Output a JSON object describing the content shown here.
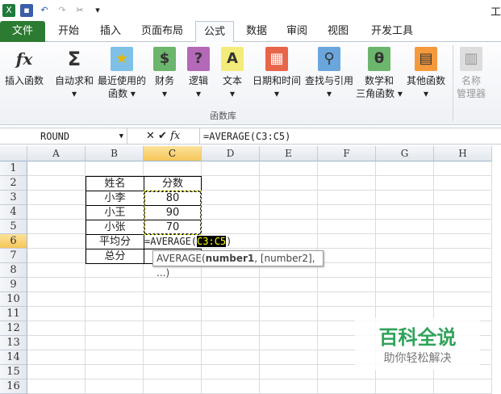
{
  "title": "工",
  "tabs": [
    "文件",
    "开始",
    "插入",
    "页面布局",
    "公式",
    "数据",
    "审阅",
    "视图",
    "开发工具"
  ],
  "active_tab": "公式",
  "ribbon": {
    "buttons": [
      {
        "label": "插入函数",
        "icon": "fx"
      },
      {
        "label": "自动求和",
        "label2": "▾",
        "icon": "Σ"
      },
      {
        "label": "最近使用的",
        "label2": "函数 ▾",
        "icon": "★"
      },
      {
        "label": "财务",
        "label2": "▾",
        "icon": "$"
      },
      {
        "label": "逻辑",
        "label2": "▾",
        "icon": "?"
      },
      {
        "label": "文本",
        "label2": "▾",
        "icon": "A"
      },
      {
        "label": "日期和时间",
        "label2": "▾",
        "icon": "▦"
      },
      {
        "label": "查找与引用",
        "label2": "▾",
        "icon": "⚲"
      },
      {
        "label": "数学和",
        "label2": "三角函数 ▾",
        "icon": "θ"
      },
      {
        "label": "其他函数",
        "label2": "▾",
        "icon": "▤"
      },
      {
        "label": "名称",
        "label2": "管理器",
        "icon": "▥"
      }
    ],
    "group_label": "函数库"
  },
  "formula_bar": {
    "name_box": "ROUND",
    "value": "=AVERAGE(C3:C5)",
    "fx": "fx"
  },
  "columns": [
    "A",
    "B",
    "C",
    "D",
    "E",
    "F",
    "G",
    "H"
  ],
  "rows": [
    "1",
    "2",
    "3",
    "4",
    "5",
    "6",
    "7",
    "8",
    "9",
    "10",
    "11",
    "12",
    "13",
    "14",
    "15",
    "16"
  ],
  "table": {
    "headers": [
      "姓名",
      "分数"
    ],
    "rows": [
      [
        "小李",
        "80"
      ],
      [
        "小王",
        "90"
      ],
      [
        "小张",
        "70"
      ],
      [
        "平均分",
        ""
      ],
      [
        "总分",
        ""
      ]
    ]
  },
  "editing": {
    "prefix": "=AVERAGE(",
    "ref": "C3:C5",
    "suffix": ")"
  },
  "tooltip": {
    "fn": "AVERAGE(",
    "bold": "number1",
    "rest": ", [number2], ...)"
  },
  "watermark": {
    "title": "百科全说",
    "sub": "助你轻松解决"
  }
}
